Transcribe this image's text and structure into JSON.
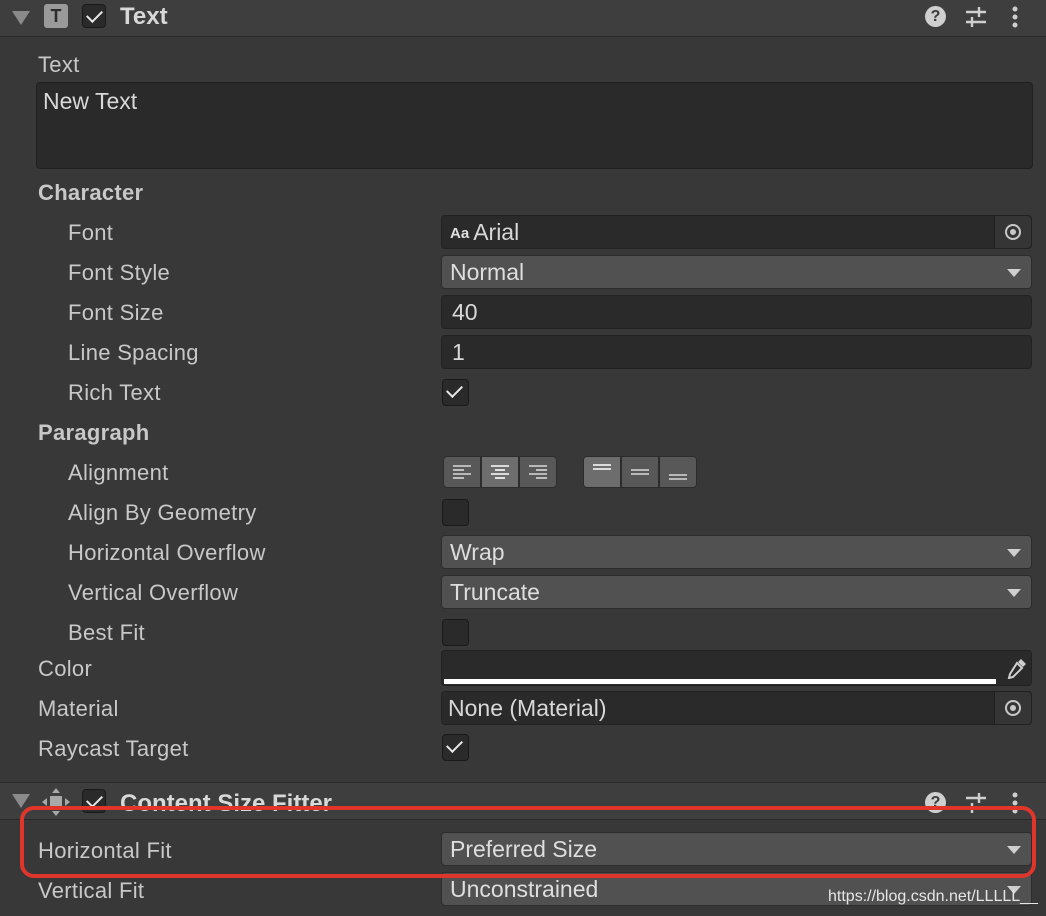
{
  "text_component": {
    "title": "Text",
    "enabled": true,
    "text_label": "Text",
    "text_value": "New Text",
    "character": {
      "header": "Character",
      "font_label": "Font",
      "font_icon_text": "Aa",
      "font_value": "Arial",
      "font_style_label": "Font Style",
      "font_style_value": "Normal",
      "font_size_label": "Font Size",
      "font_size_value": "40",
      "line_spacing_label": "Line Spacing",
      "line_spacing_value": "1",
      "rich_text_label": "Rich Text",
      "rich_text_checked": true
    },
    "paragraph": {
      "header": "Paragraph",
      "alignment_label": "Alignment",
      "horizontal_alignment": [
        "left",
        "center",
        "right"
      ],
      "horizontal_selected": "center",
      "vertical_alignment": [
        "top",
        "middle",
        "bottom"
      ],
      "vertical_selected": "top",
      "align_by_geometry_label": "Align By Geometry",
      "align_by_geometry_checked": false,
      "horizontal_overflow_label": "Horizontal Overflow",
      "horizontal_overflow_value": "Wrap",
      "vertical_overflow_label": "Vertical Overflow",
      "vertical_overflow_value": "Truncate",
      "best_fit_label": "Best Fit",
      "best_fit_checked": false
    },
    "color_label": "Color",
    "color_value": "#ffffff",
    "material_label": "Material",
    "material_value": "None (Material)",
    "raycast_target_label": "Raycast Target",
    "raycast_target_checked": true
  },
  "content_size_fitter": {
    "title": "Content Size Fitter",
    "enabled": true,
    "horizontal_fit_label": "Horizontal Fit",
    "horizontal_fit_value": "Preferred Size",
    "vertical_fit_label": "Vertical Fit",
    "vertical_fit_value": "Unconstrained"
  },
  "annotation": {
    "highlight_color": "#e0352b"
  },
  "watermark": "https://blog.csdn.net/LLLLL__"
}
